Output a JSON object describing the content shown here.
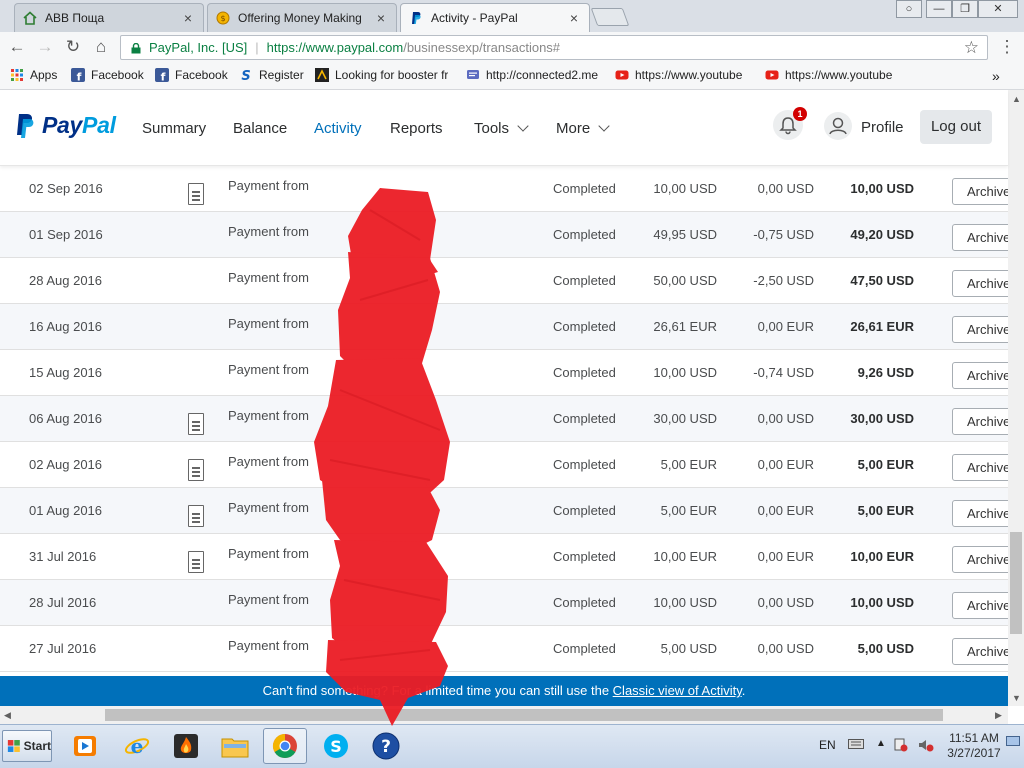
{
  "browser": {
    "tabs": [
      {
        "title": "АВВ Поща",
        "active": false
      },
      {
        "title": "Offering Money Making",
        "active": false
      },
      {
        "title": "Activity - PayPal",
        "active": true
      }
    ],
    "address": {
      "secure_label": "PayPal, Inc. [US]",
      "url_host": "https://www.paypal.com",
      "url_path": "/businessexp/transactions#"
    },
    "bookmarks": [
      {
        "label": "Apps",
        "icon": "apps-grid-icon"
      },
      {
        "label": "Facebook",
        "icon": "facebook-icon"
      },
      {
        "label": "Facebook",
        "icon": "facebook-icon"
      },
      {
        "label": "Register",
        "icon": "s-logo-icon"
      },
      {
        "label": "Looking for booster fr",
        "icon": "booster-icon"
      },
      {
        "label": "http://connected2.me",
        "icon": "chat-icon"
      },
      {
        "label": "https://www.youtube",
        "icon": "youtube-icon"
      },
      {
        "label": "https://www.youtube",
        "icon": "youtube-icon"
      }
    ],
    "overflow_label": "»"
  },
  "paypal": {
    "brand": {
      "pay": "Pay",
      "pal": "Pal"
    },
    "nav": [
      {
        "label": "Summary"
      },
      {
        "label": "Balance"
      },
      {
        "label": "Activity",
        "active": true
      },
      {
        "label": "Reports"
      },
      {
        "label": "Tools",
        "dropdown": true
      },
      {
        "label": "More",
        "dropdown": true
      }
    ],
    "notification_count": "1",
    "profile_label": "Profile",
    "logout_label": "Log out",
    "archive_label": "Archive"
  },
  "transactions": [
    {
      "date": "",
      "desc": "",
      "status": "",
      "gross": "",
      "fee": "",
      "net": "",
      "doc": false
    },
    {
      "date": "02 Sep 2016",
      "desc": "Payment from",
      "status": "Completed",
      "gross": "10,00 USD",
      "fee": "0,00 USD",
      "net": "10,00 USD",
      "doc": true
    },
    {
      "date": "01 Sep 2016",
      "desc": "Payment from",
      "status": "Completed",
      "gross": "49,95 USD",
      "fee": "-0,75 USD",
      "net": "49,20 USD",
      "doc": false
    },
    {
      "date": "28 Aug 2016",
      "desc": "Payment from",
      "status": "Completed",
      "gross": "50,00 USD",
      "fee": "-2,50 USD",
      "net": "47,50 USD",
      "doc": false
    },
    {
      "date": "16 Aug 2016",
      "desc": "Payment from",
      "status": "Completed",
      "gross": "26,61 EUR",
      "fee": "0,00 EUR",
      "net": "26,61 EUR",
      "doc": false
    },
    {
      "date": "15 Aug 2016",
      "desc": "Payment from",
      "status": "Completed",
      "gross": "10,00 USD",
      "fee": "-0,74 USD",
      "net": "9,26 USD",
      "doc": false
    },
    {
      "date": "06 Aug 2016",
      "desc": "Payment from",
      "status": "Completed",
      "gross": "30,00 USD",
      "fee": "0,00 USD",
      "net": "30,00 USD",
      "doc": true
    },
    {
      "date": "02 Aug 2016",
      "desc": "Payment from",
      "status": "Completed",
      "gross": "5,00 EUR",
      "fee": "0,00 EUR",
      "net": "5,00 EUR",
      "doc": true
    },
    {
      "date": "01 Aug 2016",
      "desc": "Payment from",
      "status": "Completed",
      "gross": "5,00 EUR",
      "fee": "0,00 EUR",
      "net": "5,00 EUR",
      "doc": true
    },
    {
      "date": "31 Jul 2016",
      "desc": "Payment from",
      "status": "Completed",
      "gross": "10,00 EUR",
      "fee": "0,00 EUR",
      "net": "10,00 EUR",
      "doc": true
    },
    {
      "date": "28 Jul 2016",
      "desc": "Payment from",
      "status": "Completed",
      "gross": "10,00 USD",
      "fee": "0,00 USD",
      "net": "10,00 USD",
      "doc": false
    },
    {
      "date": "27 Jul 2016",
      "desc": "Payment from",
      "status": "Completed",
      "gross": "5,00 USD",
      "fee": "0,00 USD",
      "net": "5,00 USD",
      "doc": false
    }
  ],
  "banner": {
    "prefix": "Can't find something? For a limited time you can still use the ",
    "link": "Classic view of Activity",
    "suffix": "."
  },
  "taskbar": {
    "start_label": "Start",
    "language": "EN",
    "time": "11:51 AM",
    "date": "3/27/2017"
  }
}
